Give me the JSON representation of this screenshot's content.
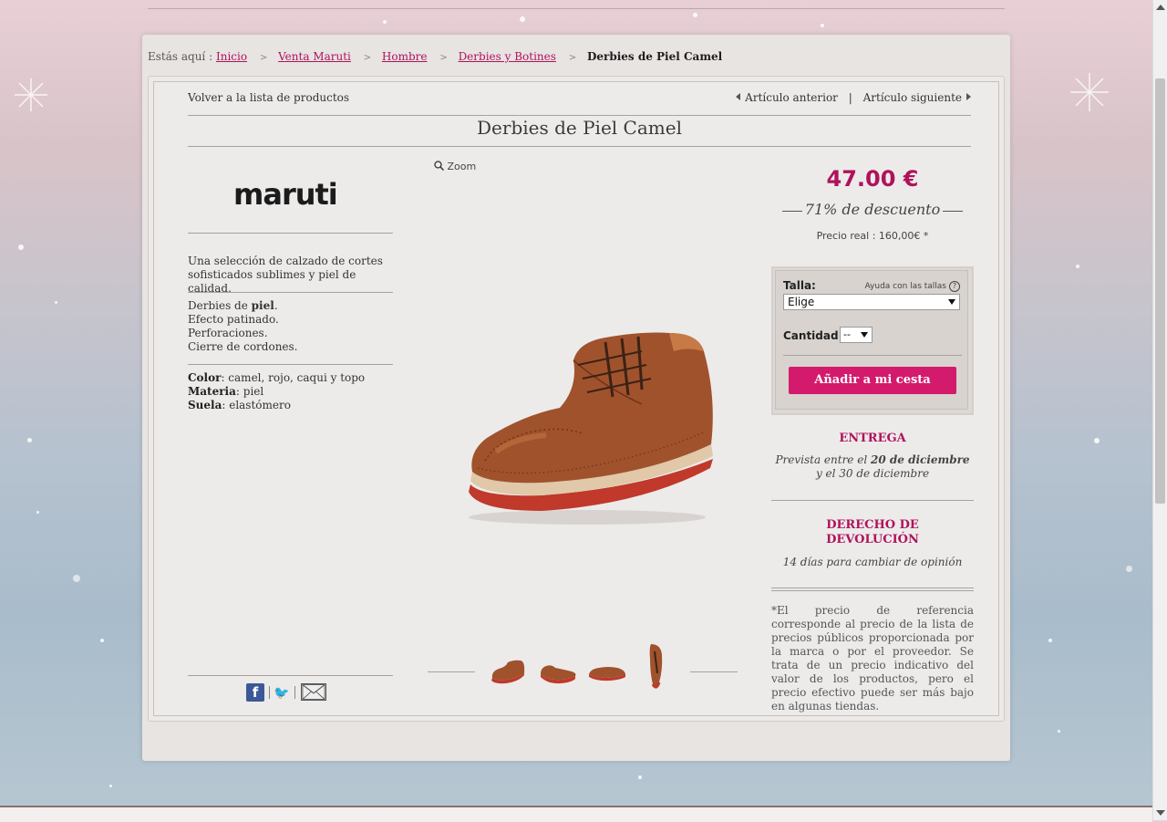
{
  "breadcrumb": {
    "prefix": "Estás aquí :",
    "items": [
      "Inicio",
      "Venta Maruti",
      "Hombre",
      "Derbies y Botines"
    ],
    "separator": ">",
    "current": "Derbies de Piel Camel"
  },
  "nav": {
    "back": "Volver a la lista de productos",
    "prev": "Artículo anterior",
    "separator": "|",
    "next": "Artículo siguiente"
  },
  "product": {
    "title": "Derbies de Piel Camel",
    "brand": "maruti",
    "description": "Una selección de calzado de cortes sofisticados sublimes y piel de calidad.",
    "features": {
      "line1_prefix": "Derbies de ",
      "line1_bold": "piel",
      "line1_suffix": ".",
      "line2": "Efecto patinado.",
      "line3": "Perforaciones.",
      "line4": "Cierre de cordones."
    },
    "specs": [
      {
        "label": "Color",
        "value": ": camel, rojo, caqui y topo"
      },
      {
        "label": "Materia",
        "value": ": piel"
      },
      {
        "label": "Suela",
        "value": ": elastómero"
      }
    ],
    "zoom_label": "Zoom"
  },
  "pricing": {
    "price": "47.00 €",
    "discount": "71% de descuento",
    "real_price": "Precio real : 160,00€ *"
  },
  "buy": {
    "size_label": "Talla:",
    "size_help": "Ayuda con las tallas",
    "size_value": "Elige",
    "qty_label": "Cantidad :",
    "qty_value": "--",
    "add_button": "Añadir a mi cesta"
  },
  "delivery": {
    "title": "ENTREGA",
    "line1_prefix": "Prevista entre el ",
    "line1_bold": "20 de diciembre",
    "line2": "y el 30 de diciembre"
  },
  "returns": {
    "title_line1": "DERECHO DE",
    "title_line2": "DEVOLUCIÓN",
    "text": "14 días para cambiar de opinión"
  },
  "note": "*El precio de referencia corresponde al precio de la lista de precios públicos proporcionada por la marca o por el proveedor. Se trata de un precio indicativo del valor de los productos, pero el precio efectivo puede ser más bajo en algunas tiendas.",
  "colors": {
    "accent": "#b0125b",
    "button": "#d41a6c",
    "shoe": "#a0522d",
    "sole": "#c0392b"
  }
}
